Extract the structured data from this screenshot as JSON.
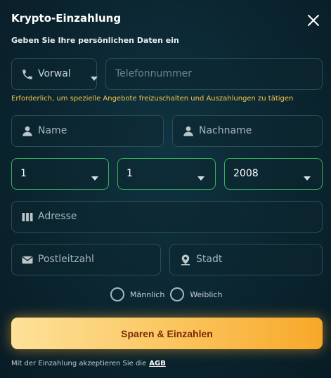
{
  "header": {
    "title": "Krypto-Einzahlung",
    "subtitle": "Geben Sie Ihre persönlichen Daten ein"
  },
  "phone": {
    "prefix_label": "Vorwal",
    "number_placeholder": "Telefonnummer",
    "note": "Erforderlich, um spezielle Angebote freizuschalten und Auszahlungen zu tätigen"
  },
  "name": {
    "first_placeholder": "Name",
    "last_placeholder": "Nachname"
  },
  "birthdate": {
    "day": "1",
    "month": "1",
    "year": "2008"
  },
  "address": {
    "placeholder": "Adresse"
  },
  "location": {
    "zip_placeholder": "Postleitzahl",
    "city_placeholder": "Stadt"
  },
  "gender": {
    "male": "Männlich",
    "female": "Weiblich"
  },
  "submit_label": "Sparen & Einzahlen",
  "terms": {
    "text": "Mit der Einzahlung akzeptieren Sie die",
    "link": "AGB"
  },
  "colors": {
    "accent_green": "#35b35d",
    "note_yellow": "#f2c54a",
    "button_orange": "#f7a829"
  }
}
